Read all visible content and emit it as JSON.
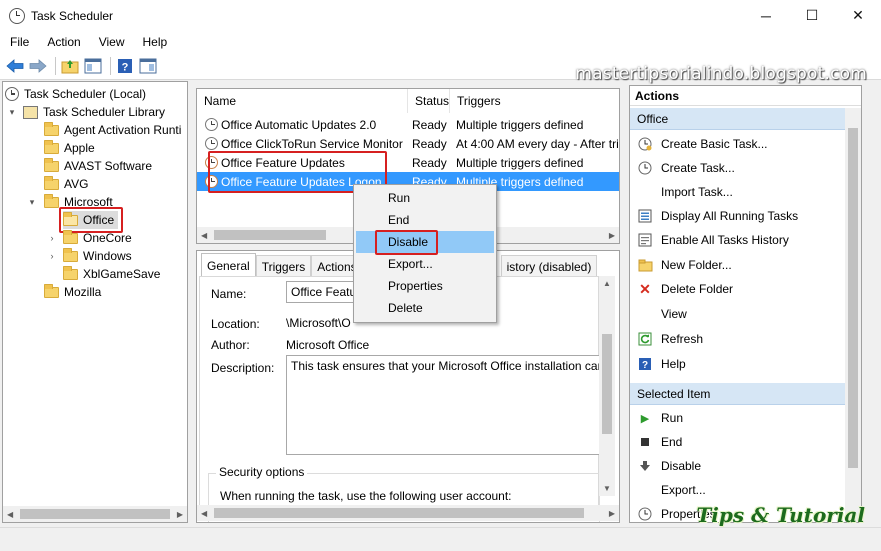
{
  "window": {
    "title": "Task Scheduler",
    "minimize": "─",
    "maximize": "☐",
    "close": "✕"
  },
  "watermark": "mastertipsorialindo.blogspot.com",
  "logo": "Tips & Tutorial",
  "menu": [
    "File",
    "Action",
    "View",
    "Help"
  ],
  "tree": {
    "root": "Task Scheduler (Local)",
    "library": "Task Scheduler Library",
    "folders": [
      "Agent Activation Runti",
      "Apple",
      "AVAST Software",
      "AVG"
    ],
    "microsoft": "Microsoft",
    "microsoft_children": [
      "Office",
      "OneCore",
      "Windows",
      "XblGameSave"
    ],
    "mozilla": "Mozilla"
  },
  "tasklist": {
    "columns": [
      "Name",
      "Status",
      "Triggers"
    ],
    "rows": [
      {
        "name": "Office Automatic Updates 2.0",
        "status": "Ready",
        "triggers": "Multiple triggers defined"
      },
      {
        "name": "Office ClickToRun Service Monitor",
        "status": "Ready",
        "triggers": "At 4:00 AM every day - After tri"
      },
      {
        "name": "Office Feature Updates",
        "status": "Ready",
        "triggers": "Multiple triggers defined"
      },
      {
        "name": "Office Feature Updates Logon",
        "status": "Ready",
        "triggers": "Multiple triggers defined"
      }
    ]
  },
  "details": {
    "tabs": [
      "General",
      "Triggers",
      "Actions",
      "istory (disabled)"
    ],
    "name_label": "Name:",
    "name_value": "Office Featur",
    "location_label": "Location:",
    "location_value": "\\Microsoft\\O",
    "author_label": "Author:",
    "author_value": "Microsoft Office",
    "description_label": "Description:",
    "description_value": "This task ensures that your Microsoft Office installation car",
    "security_title": "Security options",
    "security_text": "When running the task, use the following user account:"
  },
  "context_menu": [
    "Run",
    "End",
    "Disable",
    "Export...",
    "Properties",
    "Delete"
  ],
  "actions": {
    "header": "Actions",
    "section_office": "Office",
    "office_items": [
      {
        "icon": "create-basic-task-icon",
        "label": "Create Basic Task..."
      },
      {
        "icon": "create-task-icon",
        "label": "Create Task..."
      },
      {
        "icon": "",
        "label": "Import Task..."
      },
      {
        "icon": "running-tasks-icon",
        "label": "Display All Running Tasks"
      },
      {
        "icon": "tasks-history-icon",
        "label": "Enable All Tasks History"
      },
      {
        "icon": "new-folder-icon",
        "label": "New Folder..."
      },
      {
        "icon": "delete-folder-icon",
        "label": "Delete Folder"
      },
      {
        "icon": "",
        "label": "View"
      },
      {
        "icon": "refresh-icon",
        "label": "Refresh"
      },
      {
        "icon": "help-icon",
        "label": "Help"
      }
    ],
    "section_selected": "Selected Item",
    "selected_items": [
      {
        "icon": "run-icon",
        "label": "Run"
      },
      {
        "icon": "end-icon",
        "label": "End"
      },
      {
        "icon": "disable-icon",
        "label": "Disable"
      },
      {
        "icon": "",
        "label": "Export..."
      },
      {
        "icon": "properties-icon",
        "label": "Properties"
      }
    ]
  },
  "colors": {
    "selection": "#3399ff",
    "highlight_box": "#d62020",
    "section_bg": "#d6e6f5",
    "menu_hover": "#91c9f7"
  }
}
